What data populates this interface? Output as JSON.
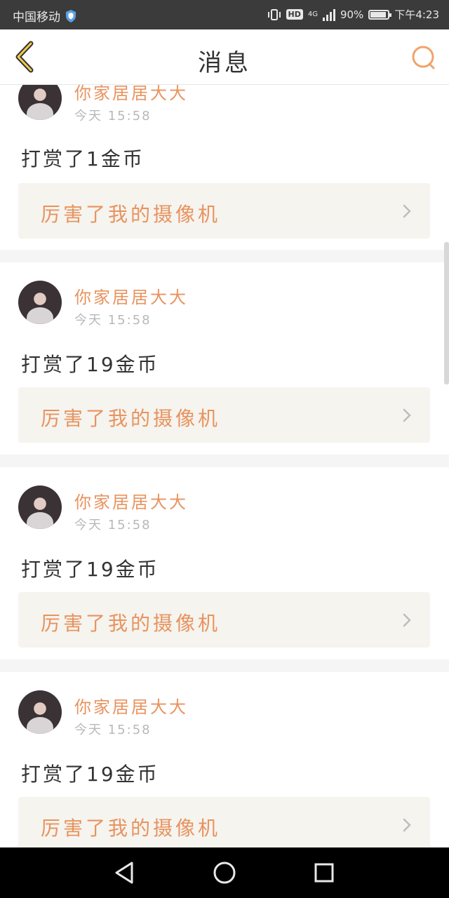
{
  "status_bar": {
    "carrier": "中国移动",
    "network": "4G",
    "battery": "90%",
    "battery_level": 0.9,
    "time": "下午4:23",
    "hd_badge": "HD"
  },
  "header": {
    "title": "消息",
    "back_icon": "chevron-left-icon",
    "search_icon": "search-icon"
  },
  "messages": [
    {
      "username": "你家居居大大",
      "time": "今天 15:58",
      "text": "打赏了1金币",
      "link": "厉害了我的摄像机"
    },
    {
      "username": "你家居居大大",
      "time": "今天 15:58",
      "text": "打赏了19金币",
      "link": "厉害了我的摄像机"
    },
    {
      "username": "你家居居大大",
      "time": "今天 15:58",
      "text": "打赏了19金币",
      "link": "厉害了我的摄像机"
    },
    {
      "username": "你家居居大大",
      "time": "今天 15:58",
      "text": "打赏了19金币",
      "link": "厉害了我的摄像机"
    }
  ],
  "colors": {
    "accent": "#e8935f",
    "status_bar_bg": "#3b3b3b",
    "link_box_bg": "#f5f4ef"
  },
  "nav_bar": {
    "back": "triangle-back-icon",
    "home": "circle-home-icon",
    "recents": "square-recents-icon"
  }
}
